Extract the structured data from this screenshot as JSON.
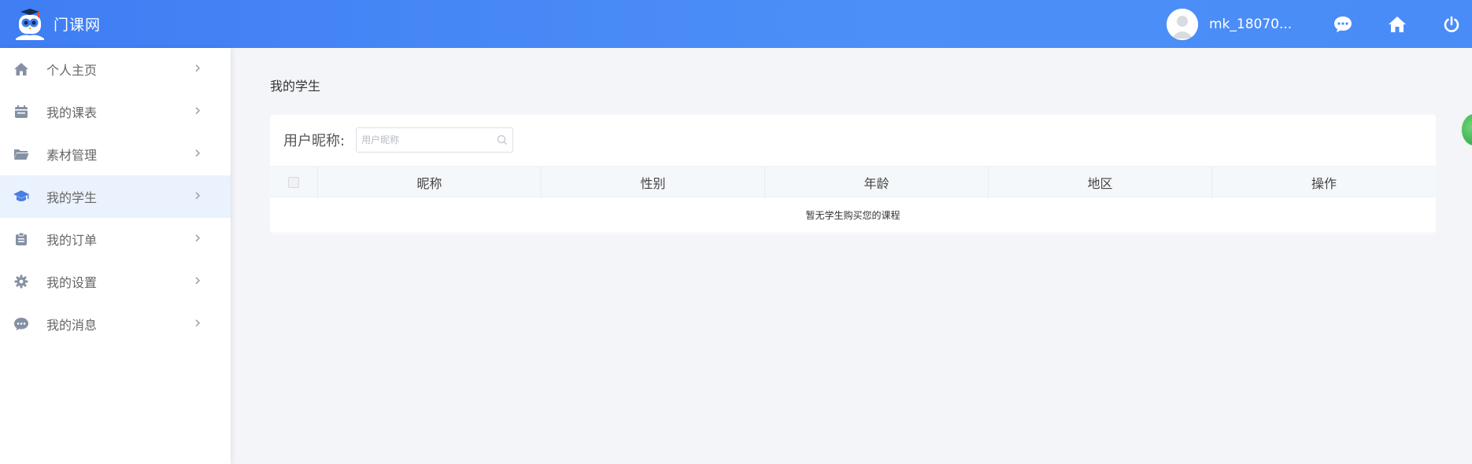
{
  "header": {
    "logo_text": "门课网",
    "username": "mk_18070..."
  },
  "icons": {
    "chat": "chat-icon",
    "home": "home-icon",
    "power": "power-icon"
  },
  "sidebar": {
    "items": [
      {
        "label": "个人主页",
        "icon": "home-icon",
        "active": false
      },
      {
        "label": "我的课表",
        "icon": "calendar-icon",
        "active": false
      },
      {
        "label": "素材管理",
        "icon": "folder-icon",
        "active": false
      },
      {
        "label": "我的学生",
        "icon": "graduation-cap-icon",
        "active": true
      },
      {
        "label": "我的订单",
        "icon": "clipboard-icon",
        "active": false
      },
      {
        "label": "我的设置",
        "icon": "gear-icon",
        "active": false
      },
      {
        "label": "我的消息",
        "icon": "message-icon",
        "active": false
      }
    ]
  },
  "main": {
    "breadcrumb": "我的学生",
    "search": {
      "label": "用户昵称:",
      "placeholder": "用户昵称",
      "value": ""
    },
    "table": {
      "columns": [
        "昵称",
        "性别",
        "年龄",
        "地区",
        "操作"
      ],
      "empty_text": "暂无学生购买您的课程"
    }
  },
  "colors": {
    "header": "#4a8cf7",
    "active_bg": "#eaf2fd",
    "icon": "#8591a3"
  }
}
